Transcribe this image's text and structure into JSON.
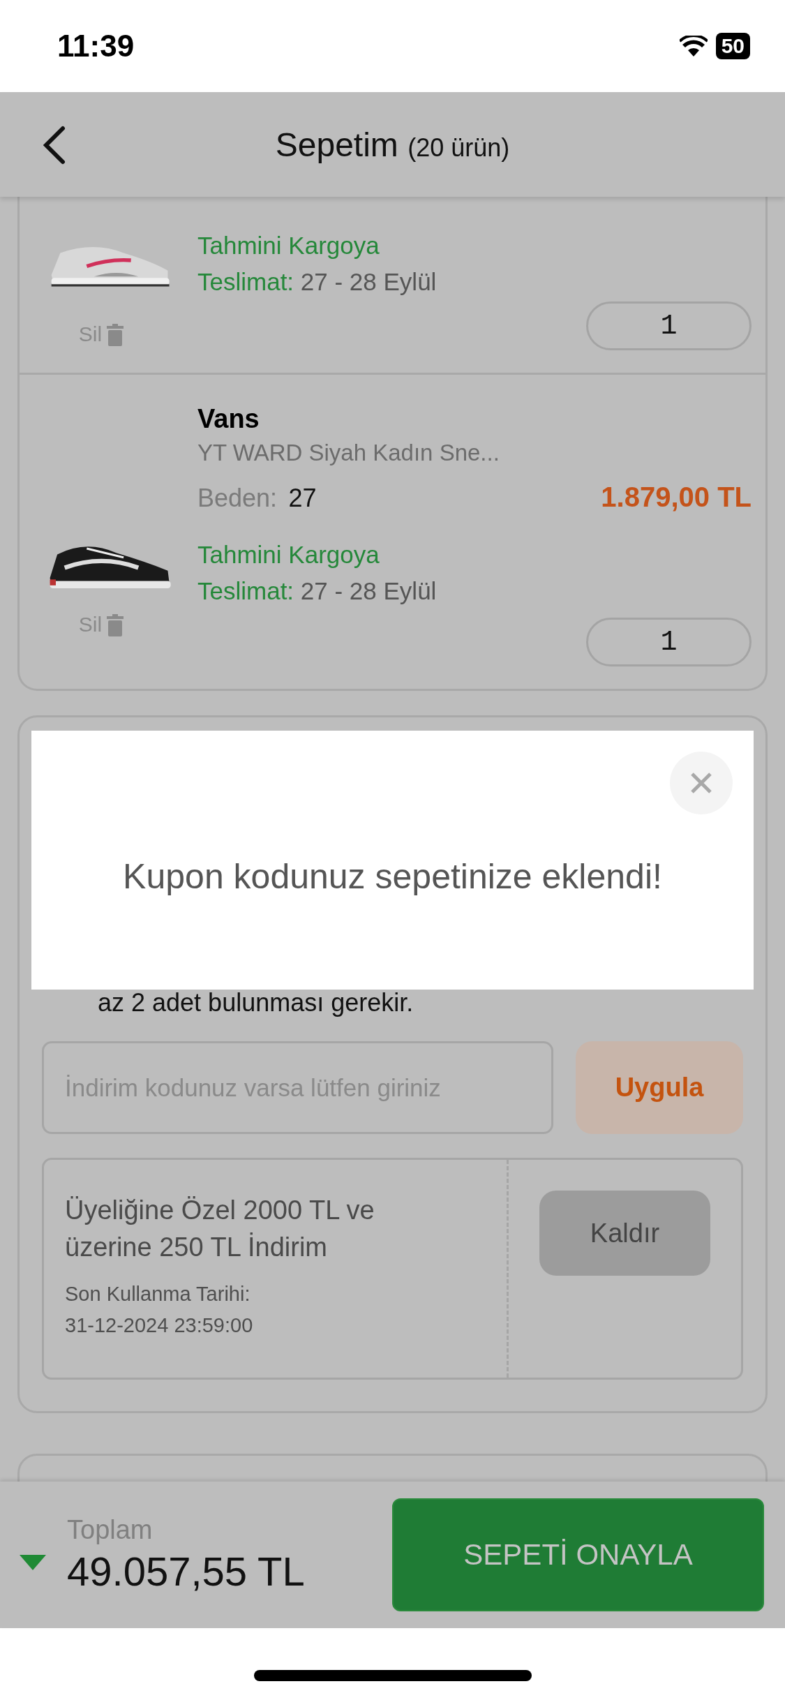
{
  "status_bar": {
    "time": "11:39",
    "battery": "50"
  },
  "header": {
    "title": "Sepetim",
    "count": "(20 ürün)"
  },
  "cart_items": [
    {
      "delivery_label": "Tahmini Kargoya",
      "delivery_prefix": "Teslimat:",
      "delivery_dates": "27 - 28 Eylül",
      "delete_label": "Sil",
      "quantity": "1"
    },
    {
      "brand": "Vans",
      "name": "YT WARD Siyah Kadın Sne...",
      "size_label": "Beden:",
      "size": "27",
      "price": "1.879,00 TL",
      "delivery_label": "Tahmini Kargoya",
      "delivery_prefix": "Teslimat:",
      "delivery_dates": "27 - 28 Eylül",
      "delete_label": "Sil",
      "quantity": "1"
    }
  ],
  "coupon": {
    "requirement": "az 2 adet bulunması gerekir.",
    "code_field": {
      "placeholder": "İndirim kodunuz varsa lütfen giriniz"
    },
    "apply_button": "Uygula",
    "applied": {
      "title": "Üyeliğine Özel 2000 TL ve üzerine 250 TL İndirim",
      "expiry_label": "Son Kullanma Tarihi:",
      "expiry": "31-12-2024 23:59:00",
      "remove_button": "Kaldır"
    }
  },
  "total": {
    "label": "Toplam",
    "amount": "49.057,55 TL"
  },
  "confirm_button": "SEPETİ ONAYLA",
  "modal": {
    "message": "Kupon kodunuz sepetinize eklendi!"
  }
}
